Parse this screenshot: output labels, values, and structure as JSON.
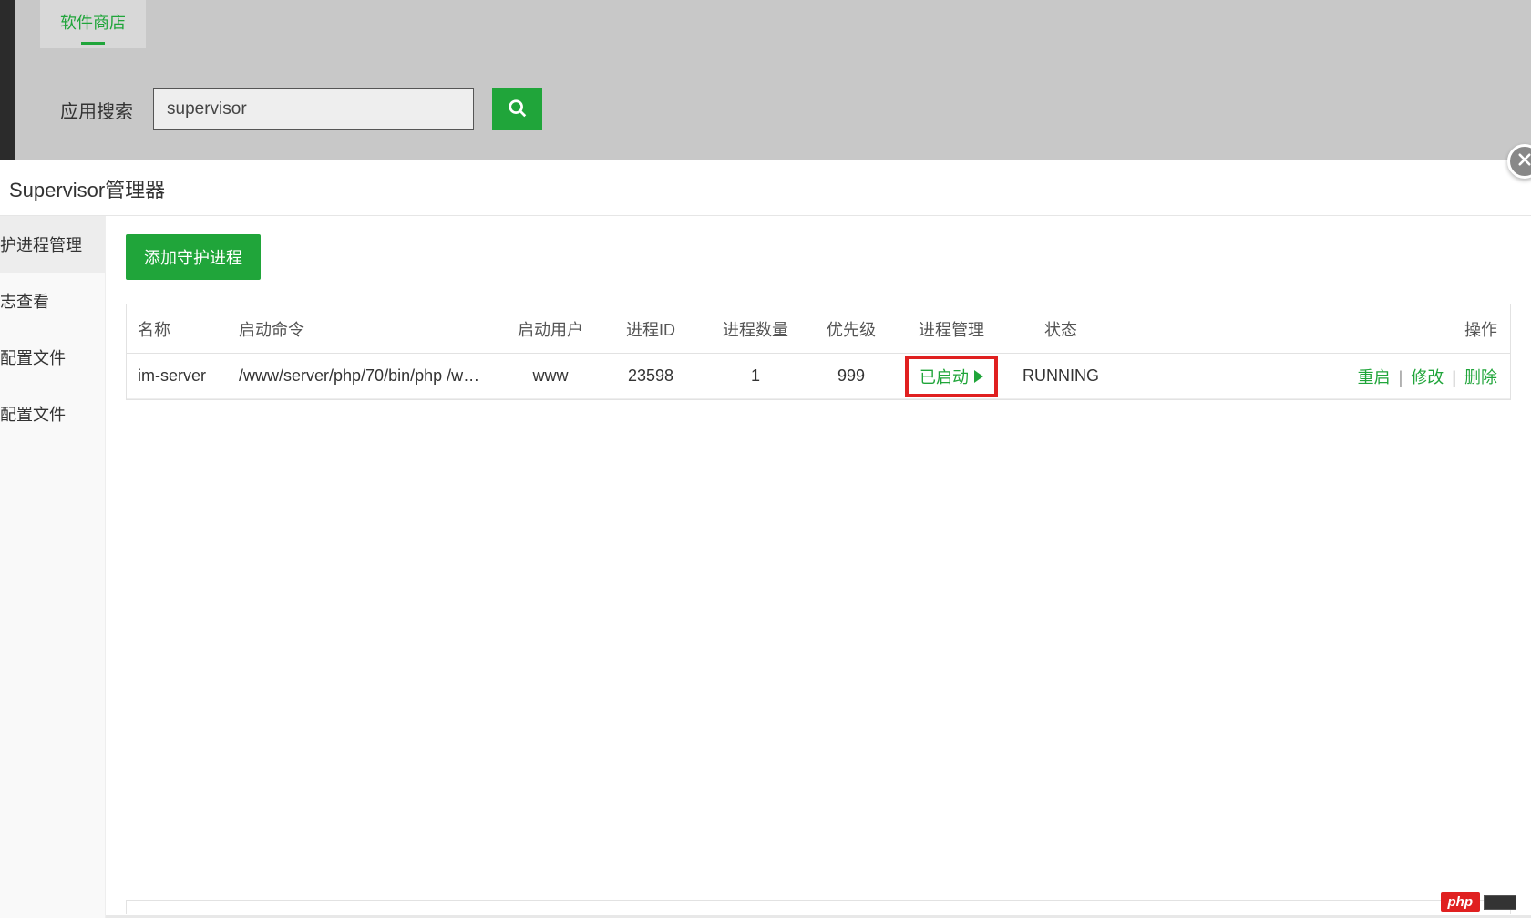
{
  "background": {
    "tab_label": "软件商店",
    "search_label": "应用搜索",
    "search_value": "supervisor"
  },
  "dialog": {
    "title": "Supervisor管理器",
    "close_label": "关闭",
    "nav": {
      "items": [
        {
          "label": "护进程管理",
          "active": true
        },
        {
          "label": "志查看",
          "active": false
        },
        {
          "label": "配置文件",
          "active": false
        },
        {
          "label": "配置文件",
          "active": false
        }
      ]
    },
    "add_button": "添加守护进程",
    "table": {
      "headers": {
        "name": "名称",
        "cmd": "启动命令",
        "user": "启动用户",
        "pid": "进程ID",
        "count": "进程数量",
        "priority": "优先级",
        "mgmt": "进程管理",
        "status": "状态",
        "ops": "操作"
      },
      "rows": [
        {
          "name": "im-server",
          "cmd": "/www/server/php/70/bin/php /w…",
          "user": "www",
          "pid": "23598",
          "count": "1",
          "priority": "999",
          "status_btn": "已启动",
          "status": "RUNNING",
          "ops": {
            "restart": "重启",
            "edit": "修改",
            "delete": "删除"
          }
        }
      ]
    }
  },
  "watermark": {
    "label": "php"
  }
}
